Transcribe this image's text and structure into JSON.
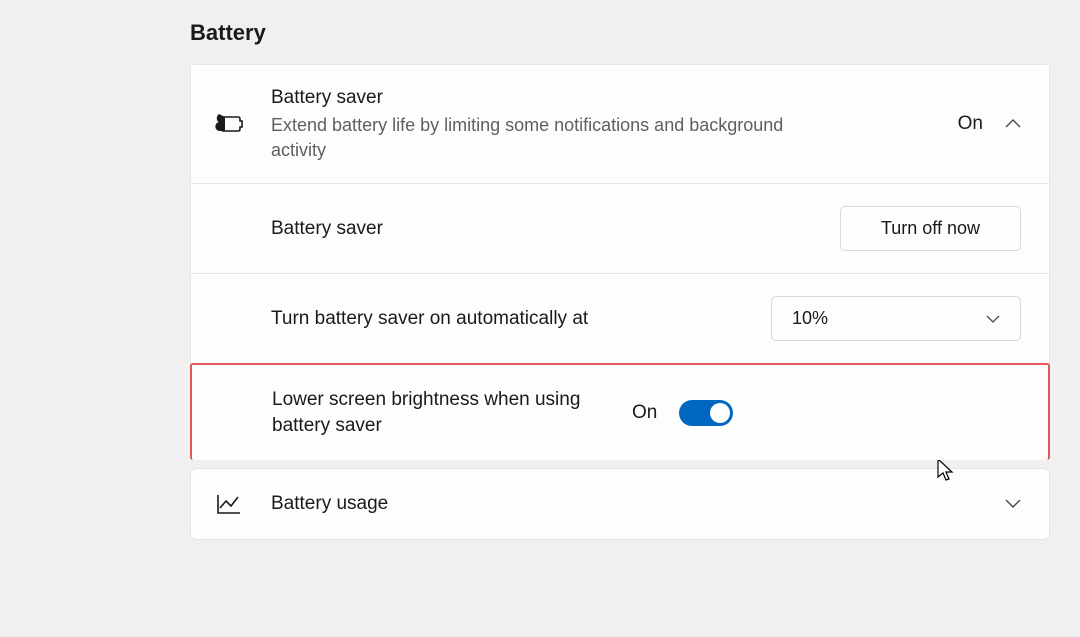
{
  "section": {
    "title": "Battery"
  },
  "batterySaver": {
    "title": "Battery saver",
    "description": "Extend battery life by limiting some notifications and background activity",
    "status": "On",
    "subLabel": "Battery saver",
    "turnOffButton": "Turn off now",
    "autoLabel": "Turn battery saver on automatically at",
    "autoValue": "10%",
    "brightnessLabel": "Lower screen brightness when using battery saver",
    "brightnessStatus": "On"
  },
  "batteryUsage": {
    "title": "Battery usage"
  }
}
